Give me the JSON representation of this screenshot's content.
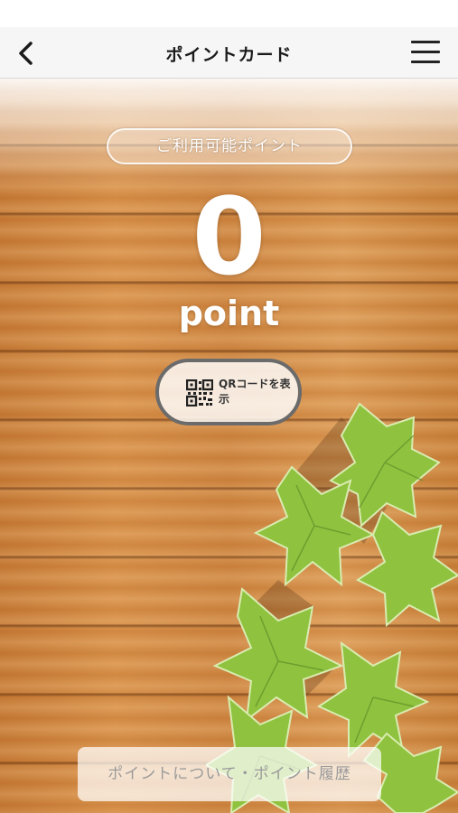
{
  "header": {
    "title": "ポイントカード",
    "back_icon": "chevron-left-icon",
    "menu_icon": "hamburger-menu-icon"
  },
  "points": {
    "label": "ご利用可能ポイント",
    "value": "0",
    "unit": "point"
  },
  "qr_button": {
    "label": "QRコードを表示",
    "icon": "qr-code-icon"
  },
  "footer": {
    "link_label": "ポイントについて・ポイント履歴"
  },
  "colors": {
    "wood": "#d08a44",
    "button_border": "#6b6b6b",
    "leaf": "#7fb53a"
  }
}
